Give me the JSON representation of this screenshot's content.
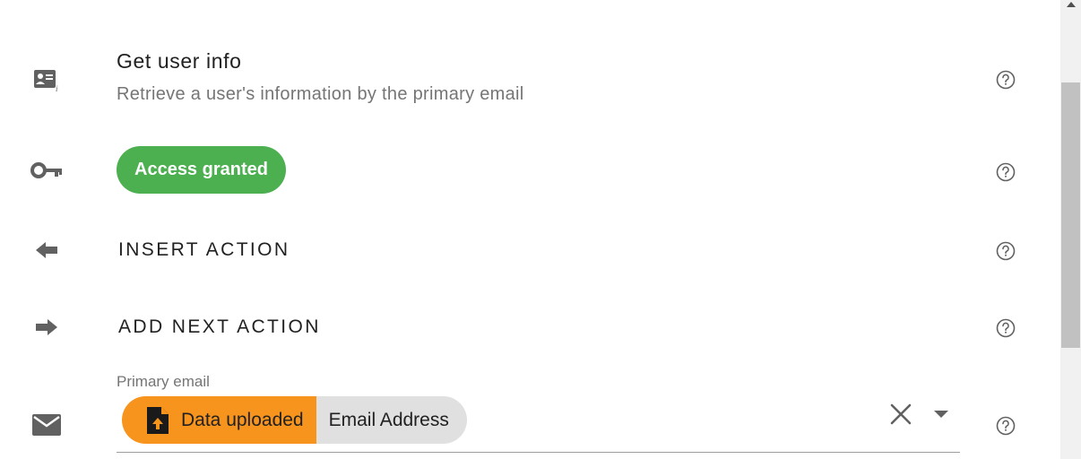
{
  "header": {
    "title": "Get user info",
    "subtitle": "Retrieve a user's information by the primary email"
  },
  "access": {
    "label": "Access granted"
  },
  "actions": {
    "insert_label": "INSERT ACTION",
    "add_next_label": "ADD NEXT ACTION"
  },
  "field": {
    "label": "Primary email",
    "chip_source": "Data uploaded",
    "chip_value": "Email Address"
  },
  "colors": {
    "success": "#4caf50",
    "upload_orange": "#f7941d",
    "chip_grey": "#e0e0e0",
    "icon_grey": "#616161"
  },
  "icons": [
    "contact-info-icon",
    "key-icon",
    "arrow-left-icon",
    "arrow-right-icon",
    "mail-icon",
    "help-icon",
    "file-upload-icon",
    "clear-icon",
    "dropdown-arrow-icon",
    "scroll-up-icon"
  ]
}
